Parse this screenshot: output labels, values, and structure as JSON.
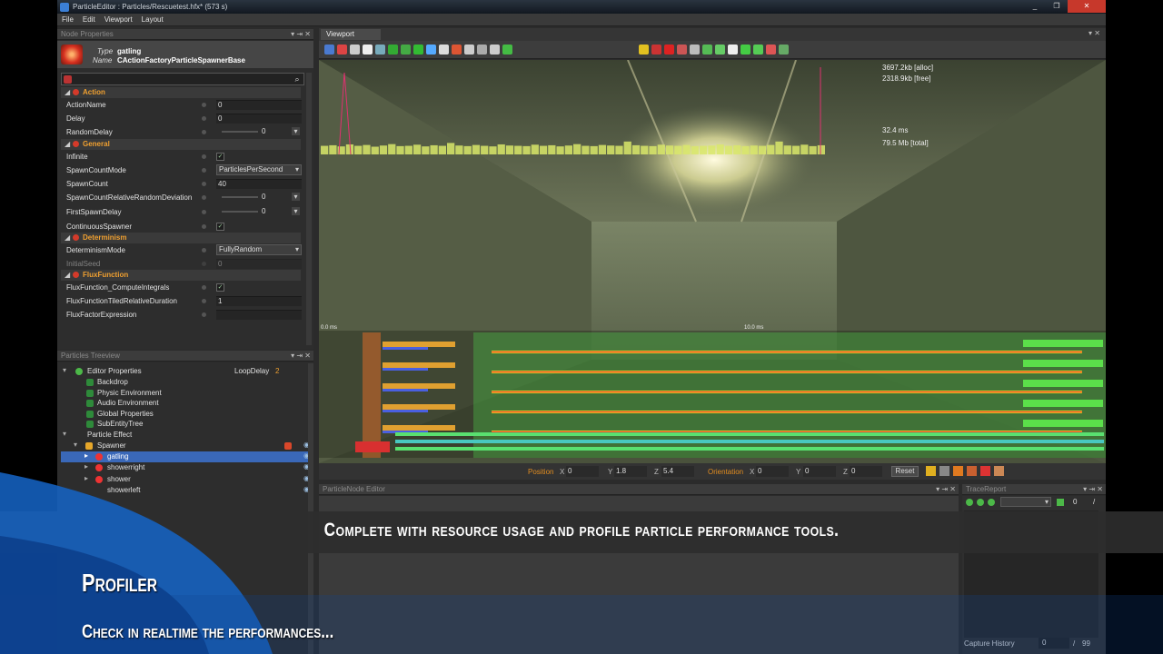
{
  "window": {
    "title": "ParticleEditor : Particles/Rescuetest.hfx* (573 s)",
    "controls": [
      "_",
      "❐",
      "✕"
    ]
  },
  "menu": [
    "File",
    "Edit",
    "Viewport",
    "Layout"
  ],
  "node_properties": {
    "panel_title": "Node Properties",
    "panel_buttons": "▾ ⇥ ✕",
    "type_label": "Type",
    "type_value": "gatling",
    "name_label": "Name",
    "name_value": "CActionFactoryParticleSpawnerBase",
    "search_icon": "magnifier-icon",
    "categories": {
      "action": "Action",
      "general": "General",
      "determinism": "Determinism",
      "flux": "FluxFunction"
    },
    "props": {
      "action_name": {
        "label": "ActionName",
        "value": "0"
      },
      "delay": {
        "label": "Delay",
        "value": "0"
      },
      "random_delay": {
        "label": "RandomDelay",
        "value": "0"
      },
      "infinite": {
        "label": "Infinite",
        "value": "✓"
      },
      "spawn_count_mode": {
        "label": "SpawnCountMode",
        "value": "ParticlesPerSecond"
      },
      "spawn_count": {
        "label": "SpawnCount",
        "value": "40"
      },
      "spawn_count_rrd": {
        "label": "SpawnCountRelativeRandomDeviation",
        "value": "0"
      },
      "first_spawn_delay": {
        "label": "FirstSpawnDelay",
        "value": "0"
      },
      "continuous_spawner": {
        "label": "ContinuousSpawner",
        "value": "✓"
      },
      "determinism_mode": {
        "label": "DeterminismMode",
        "value": "FullyRandom"
      },
      "initial_seed": {
        "label": "InitialSeed",
        "value": "0"
      },
      "flux_compute": {
        "label": "FluxFunction_ComputeIntegrals",
        "value": "✓"
      },
      "flux_tiled": {
        "label": "FluxFunctionTiledRelativeDuration",
        "value": "1"
      },
      "flux_factor": {
        "label": "FluxFactorExpression",
        "value": ""
      }
    }
  },
  "treeview": {
    "panel_title": "Particles Treeview",
    "panel_buttons": "▾ ⇥ ✕",
    "loop_delay_label": "LoopDelay",
    "loop_delay_value": "2",
    "items": {
      "editor_props": "Editor Properties",
      "backdrop": "Backdrop",
      "physic_env": "Physic Environment",
      "audio_env": "Audio Environment",
      "global_props": "Global Properties",
      "sub_entity": "SubEntityTree",
      "particle_effect": "Particle Effect",
      "spawner": "Spawner",
      "gatling": "gatling",
      "showerright": "showerright",
      "shower": "shower",
      "showerleft": "showerleft"
    }
  },
  "viewport": {
    "tab_label": "Viewport",
    "tab_buttons": "▾ ✕",
    "mem_alloc": "3697.2kb [alloc]",
    "mem_free": "2318.9kb [free]",
    "frame_ms": "32.4 ms",
    "mem_total": "79.5 Mb [total]",
    "timeline_start": "0.0 ms",
    "timeline_mid": "10.0 ms",
    "profile_bars": [
      {
        "lane": 1,
        "stripe": 0.97
      },
      {
        "lane": 2,
        "stripe": 0.97
      },
      {
        "lane": 3,
        "stripe": 0.97
      },
      {
        "lane": 4,
        "stripe": 0.97
      },
      {
        "lane": 5,
        "stripe": 0.97
      }
    ],
    "frame_graph": [
      0.3,
      0.32,
      0.28,
      0.35,
      0.3,
      0.33,
      0.27,
      0.31,
      0.36,
      0.29,
      0.3,
      0.34,
      0.28,
      0.32,
      0.3,
      0.4,
      0.31,
      0.29,
      0.33,
      0.3,
      0.28,
      0.35,
      0.31,
      0.3,
      0.29,
      0.34,
      0.3,
      0.32,
      0.28,
      0.31,
      0.36,
      0.3,
      0.29,
      0.33,
      0.31,
      0.3,
      0.45,
      0.32,
      0.3,
      0.29,
      0.34,
      0.31,
      0.3,
      0.33,
      0.29,
      0.3,
      0.31,
      0.35,
      0.3,
      0.32,
      0.29,
      0.31,
      0.3,
      0.33,
      0.45,
      0.31,
      0.3,
      0.34,
      0.29,
      0.32
    ]
  },
  "transform_bar": {
    "position_label": "Position",
    "pos_x": "0",
    "pos_y": "1.8",
    "pos_z": "5.4",
    "orientation_label": "Orientation",
    "ori_x": "0",
    "ori_y": "0",
    "ori_z": "0",
    "axis_x": "X",
    "axis_y": "Y",
    "axis_z": "Z",
    "reset_label": "Reset"
  },
  "particle_node_editor": {
    "panel_title": "ParticleNode Editor",
    "panel_buttons": "▾ ⇥ ✕"
  },
  "trace_report": {
    "panel_title": "TraceReport",
    "panel_buttons": "▾ ⇥ ✕",
    "counter": "0",
    "counter_sep": "/",
    "capture_label": "Capture History",
    "capture_value": "0",
    "capture_sep": "/",
    "capture_max": "99"
  },
  "overlay": {
    "banner": "Complete with resource usage and profile particle performance tools.",
    "title": "Profiler",
    "subtitle": "Check in realtime the performances..."
  },
  "colors": {
    "accent_orange": "#f0a030",
    "selection": "#3a68b8",
    "wave_blue": "#1565c8"
  }
}
